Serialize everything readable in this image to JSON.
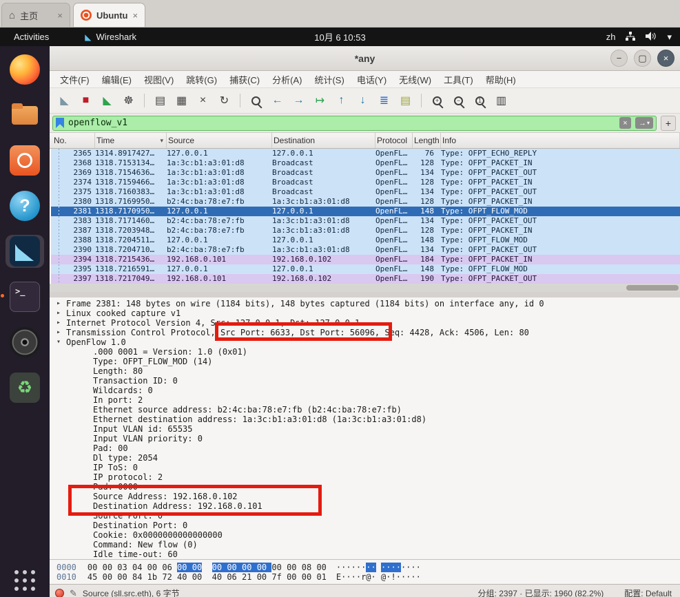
{
  "tabs": {
    "home_label": "主页",
    "vm_label": "Ubuntu"
  },
  "topbar": {
    "activities": "Activities",
    "app_name": "Wireshark",
    "clock": "10月 6 10:53",
    "lang": "zh"
  },
  "icons": {
    "fin": "◣",
    "home": "⌂",
    "tab_close": "×",
    "caret": "▾",
    "minimize": "−",
    "maximize": "▢",
    "close": "×",
    "clear": "×",
    "apply_arrow": "→",
    "plus": "+",
    "pencil": "✎"
  },
  "window": {
    "title": "*any"
  },
  "menus": [
    {
      "name": "menu-file",
      "label": "文件(F)"
    },
    {
      "name": "menu-edit",
      "label": "编辑(E)"
    },
    {
      "name": "menu-view",
      "label": "视图(V)"
    },
    {
      "name": "menu-go",
      "label": "跳转(G)"
    },
    {
      "name": "menu-capture",
      "label": "捕获(C)"
    },
    {
      "name": "menu-analyze",
      "label": "分析(A)"
    },
    {
      "name": "menu-statistics",
      "label": "统计(S)"
    },
    {
      "name": "menu-telephony",
      "label": "电话(Y)"
    },
    {
      "name": "menu-wireless",
      "label": "无线(W)"
    },
    {
      "name": "menu-tools",
      "label": "工具(T)"
    },
    {
      "name": "menu-help",
      "label": "帮助(H)"
    }
  ],
  "toolbar": {
    "items": [
      {
        "name": "start-capture-button",
        "kind": "glyph",
        "glyph": "◣",
        "cls": "c-fin-gray"
      },
      {
        "name": "stop-capture-button",
        "kind": "glyph",
        "glyph": "■",
        "cls": "c-red"
      },
      {
        "name": "restart-capture-button",
        "kind": "glyph",
        "glyph": "◣",
        "cls": "c-green"
      },
      {
        "name": "capture-options-button",
        "kind": "glyph",
        "glyph": "☸",
        "cls": "c-dark"
      },
      {
        "name": "toolbar-separator",
        "kind": "sep",
        "glyph": "",
        "cls": ""
      },
      {
        "name": "open-file-button",
        "kind": "glyph",
        "glyph": "▤",
        "cls": "c-dark"
      },
      {
        "name": "save-file-button",
        "kind": "glyph",
        "glyph": "▦",
        "cls": "c-dark"
      },
      {
        "name": "close-file-button",
        "kind": "glyph",
        "glyph": "×",
        "cls": "c-dark"
      },
      {
        "name": "reload-button",
        "kind": "glyph",
        "glyph": "↻",
        "cls": "c-dark"
      },
      {
        "name": "toolbar-separator",
        "kind": "sep",
        "glyph": "",
        "cls": ""
      },
      {
        "name": "find-packet-button",
        "kind": "mag",
        "glyph": "",
        "cls": "c-dark"
      },
      {
        "name": "go-back-button",
        "kind": "glyph",
        "glyph": "←",
        "cls": "c-teal"
      },
      {
        "name": "go-forward-button",
        "kind": "glyph",
        "glyph": "→",
        "cls": "c-teal"
      },
      {
        "name": "go-to-packet-button",
        "kind": "glyph",
        "glyph": "↦",
        "cls": "c-green"
      },
      {
        "name": "go-top-button",
        "kind": "glyph",
        "glyph": "↑",
        "cls": "c-teal"
      },
      {
        "name": "go-bottom-button",
        "kind": "glyph",
        "glyph": "↓",
        "cls": "c-teal"
      },
      {
        "name": "auto-scroll-button",
        "kind": "glyph",
        "glyph": "≣",
        "cls": "c-blue"
      },
      {
        "name": "colorize-button",
        "kind": "glyph",
        "glyph": "▤",
        "cls": "c-olive"
      },
      {
        "name": "toolbar-separator",
        "kind": "sep",
        "glyph": "",
        "cls": ""
      },
      {
        "name": "zoom-in-button",
        "kind": "mag",
        "glyph": "+",
        "cls": "c-dark"
      },
      {
        "name": "zoom-out-button",
        "kind": "mag",
        "glyph": "−",
        "cls": "c-dark"
      },
      {
        "name": "zoom-reset-button",
        "kind": "mag",
        "glyph": "1",
        "cls": "c-dark"
      },
      {
        "name": "resize-columns-button",
        "kind": "glyph",
        "glyph": "▥",
        "cls": "c-dark"
      }
    ]
  },
  "filter": {
    "value": "openflow_v1"
  },
  "packet_list": {
    "columns": [
      {
        "label": "No.",
        "cls": "c-no",
        "caret": ""
      },
      {
        "label": "Time",
        "cls": "c-time",
        "caret": "▾"
      },
      {
        "label": "Source",
        "cls": "c-src",
        "caret": ""
      },
      {
        "label": "Destination",
        "cls": "c-dst",
        "caret": ""
      },
      {
        "label": "Protocol",
        "cls": "c-proto",
        "caret": ""
      },
      {
        "label": "Length",
        "cls": "c-len",
        "caret": ""
      },
      {
        "label": "Info",
        "cls": "c-info",
        "caret": ""
      }
    ],
    "rows": [
      {
        "no": "2365",
        "time": "1314.8917427…",
        "src": "127.0.0.1",
        "dst": "127.0.0.1",
        "proto": "OpenFL…",
        "len": "76",
        "info": "Type: OFPT_ECHO_REPLY",
        "style": "blue"
      },
      {
        "no": "2368",
        "time": "1318.7153134…",
        "src": "1a:3c:b1:a3:01:d8",
        "dst": "Broadcast",
        "proto": "OpenFL…",
        "len": "128",
        "info": "Type: OFPT_PACKET_IN",
        "style": "blue"
      },
      {
        "no": "2369",
        "time": "1318.7154636…",
        "src": "1a:3c:b1:a3:01:d8",
        "dst": "Broadcast",
        "proto": "OpenFL…",
        "len": "134",
        "info": "Type: OFPT_PACKET_OUT",
        "style": "blue"
      },
      {
        "no": "2374",
        "time": "1318.7159466…",
        "src": "1a:3c:b1:a3:01:d8",
        "dst": "Broadcast",
        "proto": "OpenFL…",
        "len": "128",
        "info": "Type: OFPT_PACKET_IN",
        "style": "blue"
      },
      {
        "no": "2375",
        "time": "1318.7160383…",
        "src": "1a:3c:b1:a3:01:d8",
        "dst": "Broadcast",
        "proto": "OpenFL…",
        "len": "134",
        "info": "Type: OFPT_PACKET_OUT",
        "style": "blue"
      },
      {
        "no": "2380",
        "time": "1318.7169950…",
        "src": "b2:4c:ba:78:e7:fb",
        "dst": "1a:3c:b1:a3:01:d8",
        "proto": "OpenFL…",
        "len": "128",
        "info": "Type: OFPT_PACKET_IN",
        "style": "blue"
      },
      {
        "no": "2381",
        "time": "1318.7170950…",
        "src": "127.0.0.1",
        "dst": "127.0.0.1",
        "proto": "OpenFL…",
        "len": "148",
        "info": "Type: OFPT_FLOW_MOD",
        "style": "selected"
      },
      {
        "no": "2383",
        "time": "1318.7171460…",
        "src": "b2:4c:ba:78:e7:fb",
        "dst": "1a:3c:b1:a3:01:d8",
        "proto": "OpenFL…",
        "len": "134",
        "info": "Type: OFPT_PACKET_OUT",
        "style": "blue"
      },
      {
        "no": "2387",
        "time": "1318.7203948…",
        "src": "b2:4c:ba:78:e7:fb",
        "dst": "1a:3c:b1:a3:01:d8",
        "proto": "OpenFL…",
        "len": "128",
        "info": "Type: OFPT_PACKET_IN",
        "style": "blue"
      },
      {
        "no": "2388",
        "time": "1318.7204511…",
        "src": "127.0.0.1",
        "dst": "127.0.0.1",
        "proto": "OpenFL…",
        "len": "148",
        "info": "Type: OFPT_FLOW_MOD",
        "style": "blue"
      },
      {
        "no": "2390",
        "time": "1318.7204710…",
        "src": "b2:4c:ba:78:e7:fb",
        "dst": "1a:3c:b1:a3:01:d8",
        "proto": "OpenFL…",
        "len": "134",
        "info": "Type: OFPT_PACKET_OUT",
        "style": "blue"
      },
      {
        "no": "2394",
        "time": "1318.7215436…",
        "src": "192.168.0.101",
        "dst": "192.168.0.102",
        "proto": "OpenFL…",
        "len": "184",
        "info": "Type: OFPT_PACKET_IN",
        "style": "purple"
      },
      {
        "no": "2395",
        "time": "1318.7216591…",
        "src": "127.0.0.1",
        "dst": "127.0.0.1",
        "proto": "OpenFL…",
        "len": "148",
        "info": "Type: OFPT_FLOW_MOD",
        "style": "blue"
      },
      {
        "no": "2397",
        "time": "1318.7217049…",
        "src": "192.168.0.101",
        "dst": "192.168.0.102",
        "proto": "OpenFL…",
        "len": "190",
        "info": "Type: OFPT_PACKET_OUT",
        "style": "purple"
      }
    ]
  },
  "details": {
    "lines": [
      {
        "expand": "collapsed",
        "depth": "d0",
        "text": "Frame 2381: 148 bytes on wire (1184 bits), 148 bytes captured (1184 bits) on interface any, id 0"
      },
      {
        "expand": "collapsed",
        "depth": "d0",
        "text": "Linux cooked capture v1"
      },
      {
        "expand": "collapsed",
        "depth": "d0",
        "text": "Internet Protocol Version 4, Src: 127.0.0.1, Dst: 127.0.0.1"
      },
      {
        "expand": "collapsed",
        "depth": "d0",
        "text": "Transmission Control Protocol, Src Port: 6633, Dst Port: 56096, Seq: 4428, Ack: 4506, Len: 80"
      },
      {
        "expand": "expanded",
        "depth": "d0",
        "text": "OpenFlow 1.0"
      },
      {
        "expand": "leaf",
        "depth": "d1",
        "text": ".000 0001 = Version: 1.0 (0x01)"
      },
      {
        "expand": "leaf",
        "depth": "d1",
        "text": "Type: OFPT_FLOW_MOD (14)"
      },
      {
        "expand": "leaf",
        "depth": "d1",
        "text": "Length: 80"
      },
      {
        "expand": "leaf",
        "depth": "d1",
        "text": "Transaction ID: 0"
      },
      {
        "expand": "leaf",
        "depth": "d1",
        "text": "Wildcards: 0"
      },
      {
        "expand": "leaf",
        "depth": "d1",
        "text": "In port: 2"
      },
      {
        "expand": "leaf",
        "depth": "d1",
        "text": "Ethernet source address: b2:4c:ba:78:e7:fb (b2:4c:ba:78:e7:fb)"
      },
      {
        "expand": "leaf",
        "depth": "d1",
        "text": "Ethernet destination address: 1a:3c:b1:a3:01:d8 (1a:3c:b1:a3:01:d8)"
      },
      {
        "expand": "leaf",
        "depth": "d1",
        "text": "Input VLAN id: 65535"
      },
      {
        "expand": "leaf",
        "depth": "d1",
        "text": "Input VLAN priority: 0"
      },
      {
        "expand": "leaf",
        "depth": "d1",
        "text": "Pad: 00"
      },
      {
        "expand": "leaf",
        "depth": "d1",
        "text": "Dl type: 2054"
      },
      {
        "expand": "leaf",
        "depth": "d1",
        "text": "IP ToS: 0"
      },
      {
        "expand": "leaf",
        "depth": "d1",
        "text": "IP protocol: 2"
      },
      {
        "expand": "leaf",
        "depth": "d1",
        "text": "Pad: 0000"
      },
      {
        "expand": "leaf",
        "depth": "d1",
        "text": "Source Address: 192.168.0.102"
      },
      {
        "expand": "leaf",
        "depth": "d1",
        "text": "Destination Address: 192.168.0.101"
      },
      {
        "expand": "leaf",
        "depth": "d1",
        "text": "Source Port: 0"
      },
      {
        "expand": "leaf",
        "depth": "d1",
        "text": "Destination Port: 0"
      },
      {
        "expand": "leaf",
        "depth": "d1",
        "text": "Cookie: 0x0000000000000000"
      },
      {
        "expand": "leaf",
        "depth": "d1",
        "text": "Command: New flow (0)"
      },
      {
        "expand": "leaf",
        "depth": "d1",
        "text": "Idle time-out: 60"
      }
    ]
  },
  "hex": {
    "rows": [
      {
        "offset": "0000",
        "bytes": [
          [
            "00",
            "00",
            "03",
            "04",
            "00",
            "06",
            "00",
            "00"
          ],
          [
            "00",
            "00",
            "00",
            "00",
            "00",
            "00",
            "08",
            "00"
          ]
        ],
        "ascii": [
          [
            "·",
            "·",
            "·",
            "·",
            "·",
            "·",
            "·",
            "·"
          ],
          [
            "·",
            "·",
            "·",
            "·",
            "·",
            "·",
            "·",
            "·"
          ]
        ],
        "hl_g1": [
          6,
          7
        ],
        "hl_g2": [
          0,
          1,
          2,
          3
        ]
      },
      {
        "offset": "0010",
        "bytes": [
          [
            "45",
            "00",
            "00",
            "84",
            "1b",
            "72",
            "40",
            "00"
          ],
          [
            "40",
            "06",
            "21",
            "00",
            "7f",
            "00",
            "00",
            "01"
          ]
        ],
        "ascii": [
          [
            "E",
            "·",
            "·",
            "·",
            "·",
            "r",
            "@",
            "·"
          ],
          [
            "@",
            "·",
            "!",
            "·",
            "·",
            "·",
            "·",
            "·"
          ]
        ],
        "hl_g1": [],
        "hl_g2": []
      }
    ]
  },
  "status": {
    "left": "Source (sll.src.eth), 6 字节",
    "packets": "分组: 2397 · 已显示: 1960 (82.2%)",
    "profile": "配置: Default"
  },
  "dock": {
    "items": [
      {
        "name": "firefox-icon",
        "glyph": ""
      },
      {
        "name": "files-icon",
        "glyph": ""
      },
      {
        "name": "ubuntu-software-icon",
        "glyph": ""
      },
      {
        "name": "help-icon",
        "glyph": "?"
      },
      {
        "name": "wireshark-dock-icon",
        "glyph": ""
      },
      {
        "name": "terminal-icon",
        "glyph": ">_"
      },
      {
        "name": "media-disc-icon",
        "glyph": ""
      },
      {
        "name": "recycle-icon",
        "glyph": "♻"
      }
    ]
  }
}
